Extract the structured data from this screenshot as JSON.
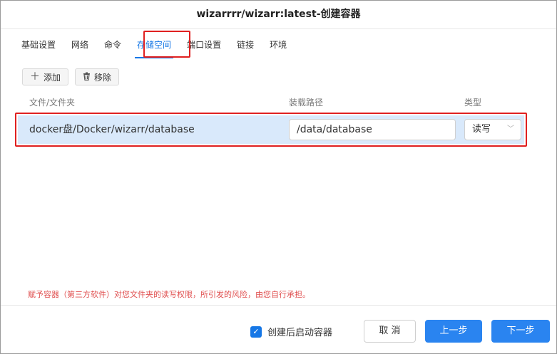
{
  "window": {
    "title": "wizarrrr/wizarr:latest-创建容器"
  },
  "tabs": [
    {
      "label": "基础设置",
      "active": false
    },
    {
      "label": "网络",
      "active": false
    },
    {
      "label": "命令",
      "active": false
    },
    {
      "label": "存储空间",
      "active": true
    },
    {
      "label": "端口设置",
      "active": false
    },
    {
      "label": "链接",
      "active": false
    },
    {
      "label": "环境",
      "active": false
    }
  ],
  "toolbar": {
    "add_label": "添加",
    "add_icon": "plus-icon",
    "remove_label": "移除",
    "remove_icon": "trash-icon"
  },
  "table": {
    "headers": [
      "文件/文件夹",
      "装载路径",
      "类型"
    ],
    "rows": [
      {
        "path": "docker盘/Docker/wizarr/database",
        "mount": "/data/database",
        "type": "读写"
      }
    ]
  },
  "warning": "赋予容器（第三方软件）对您文件夹的读写权限，所引发的风险，由您自行承担。",
  "footer": {
    "checkbox_label": "创建后启动容器",
    "checkbox_checked": true,
    "cancel_label": "取 消",
    "prev_label": "上一步",
    "next_label": "下一步"
  },
  "colors": {
    "accent": "#1677e6",
    "highlight_border": "#e02020",
    "selected_row": "#d9e9fb",
    "warning_text": "#e05050"
  }
}
